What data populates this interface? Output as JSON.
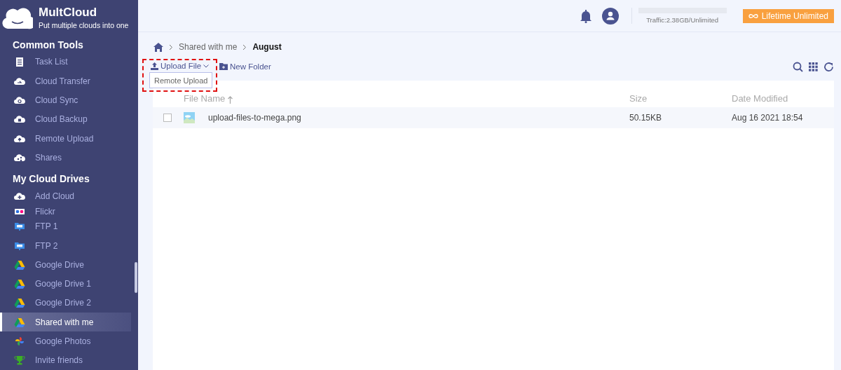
{
  "brand": {
    "name": "MultCloud",
    "tagline": "Put multiple clouds into one"
  },
  "sidebar": {
    "sections": [
      {
        "title": "Common Tools",
        "items": [
          {
            "label": "Task List",
            "kind": "tasks",
            "selected": false
          },
          {
            "label": "Cloud Transfer",
            "kind": "transfer",
            "selected": false
          },
          {
            "label": "Cloud Sync",
            "kind": "sync",
            "selected": false
          },
          {
            "label": "Cloud Backup",
            "kind": "backup",
            "selected": false
          },
          {
            "label": "Remote Upload",
            "kind": "upload",
            "selected": false
          },
          {
            "label": "Shares",
            "kind": "share",
            "selected": false
          }
        ]
      },
      {
        "title": "My Cloud Drives",
        "items": [
          {
            "label": "Add Cloud",
            "kind": "add",
            "selected": false
          },
          {
            "label": "Flickr",
            "kind": "flickr",
            "selected": false
          },
          {
            "label": "FTP 1",
            "kind": "ftp",
            "selected": false
          },
          {
            "label": "FTP 2",
            "kind": "ftp",
            "selected": false
          },
          {
            "label": "Google Drive",
            "kind": "drive",
            "selected": false
          },
          {
            "label": "Google Drive 1",
            "kind": "drive",
            "selected": false
          },
          {
            "label": "Google Drive 2",
            "kind": "drive",
            "selected": false
          },
          {
            "label": "Shared with me",
            "kind": "drive",
            "selected": true
          },
          {
            "label": "Google Photos",
            "kind": "photos",
            "selected": false
          },
          {
            "label": "Invite friends",
            "kind": "trophy",
            "selected": false
          }
        ]
      }
    ]
  },
  "header": {
    "traffic": "Traffic:2.38GB/Unlimited",
    "plan_button": "Lifetime Unlimited"
  },
  "breadcrumb": [
    "Shared with me",
    "August"
  ],
  "toolbar": {
    "upload": "Upload File",
    "new_folder": "New Folder",
    "dropdown": [
      "Remote Upload"
    ]
  },
  "table": {
    "columns": [
      "File Name",
      "Size",
      "Date Modified"
    ],
    "rows": [
      {
        "name": "upload-files-to-mega.png",
        "size": "50.15KB",
        "modified": "Aug 16 2021 18:54",
        "checked": false
      }
    ]
  }
}
